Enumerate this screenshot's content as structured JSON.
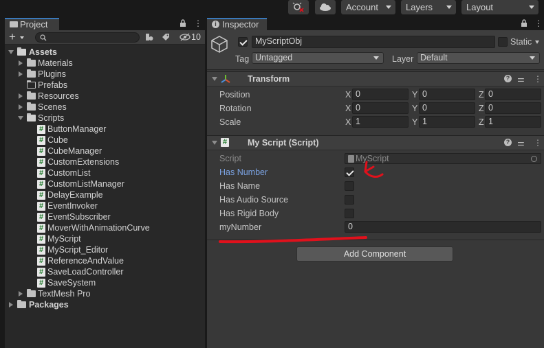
{
  "toolbar": {
    "account_label": "Account",
    "layers_label": "Layers",
    "layout_label": "Layout"
  },
  "project": {
    "tab_label": "Project",
    "hidden_count": "10",
    "tree": {
      "assets": "Assets",
      "materials": "Materials",
      "plugins": "Plugins",
      "prefabs": "Prefabs",
      "resources": "Resources",
      "scenes": "Scenes",
      "scripts": "Scripts",
      "script_files": [
        "ButtonManager",
        "Cube",
        "CubeManager",
        "CustomExtensions",
        "CustomList",
        "CustomListManager",
        "DelayExample",
        "EventInvoker",
        "EventSubscriber",
        "MoverWithAnimationCurve",
        "MyScript",
        "MyScript_Editor",
        "ReferenceAndValue",
        "SaveLoadController",
        "SaveSystem"
      ],
      "textmesh": "TextMesh Pro",
      "packages": "Packages"
    }
  },
  "inspector": {
    "tab_label": "Inspector",
    "object_name": "MyScriptObj",
    "static_label": "Static",
    "tag_label": "Tag",
    "tag_value": "Untagged",
    "layer_label": "Layer",
    "layer_value": "Default",
    "transform": {
      "title": "Transform",
      "position_label": "Position",
      "rotation_label": "Rotation",
      "scale_label": "Scale",
      "x": "X",
      "y": "Y",
      "z": "Z",
      "position": [
        "0",
        "0",
        "0"
      ],
      "rotation": [
        "0",
        "0",
        "0"
      ],
      "scale": [
        "1",
        "1",
        "1"
      ]
    },
    "myscript": {
      "title": "My Script (Script)",
      "script_label": "Script",
      "script_value": "MyScript",
      "has_number_label": "Has Number",
      "has_number": true,
      "has_name_label": "Has Name",
      "has_audio_label": "Has Audio Source",
      "has_rigid_label": "Has Rigid Body",
      "mynumber_label": "myNumber",
      "mynumber_value": "0"
    },
    "add_component_label": "Add Component"
  },
  "colors": {
    "highlight_label": "#7ba3e3",
    "annotation_red": "#e0111c",
    "tab_accent": "#3a79bb"
  }
}
